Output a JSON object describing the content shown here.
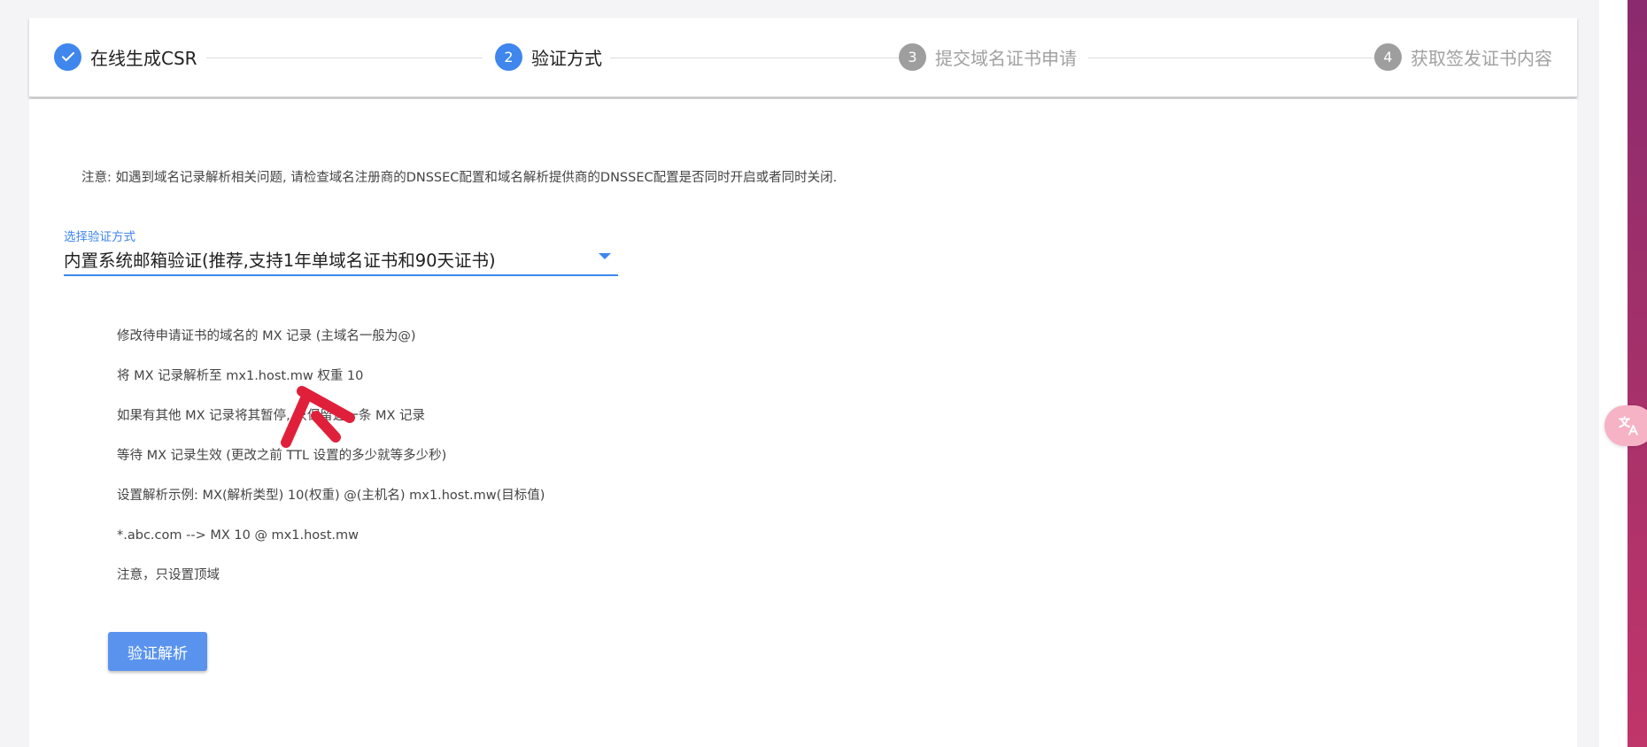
{
  "stepper": {
    "steps": [
      {
        "number": "",
        "label": "在线生成CSR",
        "state": "completed"
      },
      {
        "number": "2",
        "label": "验证方式",
        "state": "active"
      },
      {
        "number": "3",
        "label": "提交域名证书申请",
        "state": "inactive"
      },
      {
        "number": "4",
        "label": "获取签发证书内容",
        "state": "inactive"
      }
    ]
  },
  "note": "注意: 如遇到域名记录解析相关问题, 请检查域名注册商的DNSSEC配置和域名解析提供商的DNSSEC配置是否同时开启或者同时关闭.",
  "verification": {
    "label": "选择验证方式",
    "selected": "内置系统邮箱验证(推荐,支持1年单域名证书和90天证书)"
  },
  "instructions": [
    "修改待申请证书的域名的 MX 记录 (主域名一般为@)",
    "将 MX 记录解析至 mx1.host.mw 权重 10",
    "如果有其他 MX 记录将其暂停, 只保留这一条 MX 记录",
    "等待 MX 记录生效 (更改之前 TTL 设置的多少就等多少秒)",
    "设置解析示例: MX(解析类型) 10(权重) @(主机名) mx1.host.mw(目标值)",
    "*.abc.com --> MX 10 @ mx1.host.mw",
    "注意，只设置顶域"
  ],
  "buttons": {
    "verify": "验证解析"
  },
  "colors": {
    "primary": "#3f86ed",
    "button": "#5a93ee",
    "inactive_step": "#9e9e9e",
    "annotation": "#e0203a"
  },
  "icons": {
    "completed_step": "check-icon",
    "dropdown": "caret-down-icon",
    "translate": "translate-icon",
    "annotation": "arrow-pointer-icon"
  }
}
